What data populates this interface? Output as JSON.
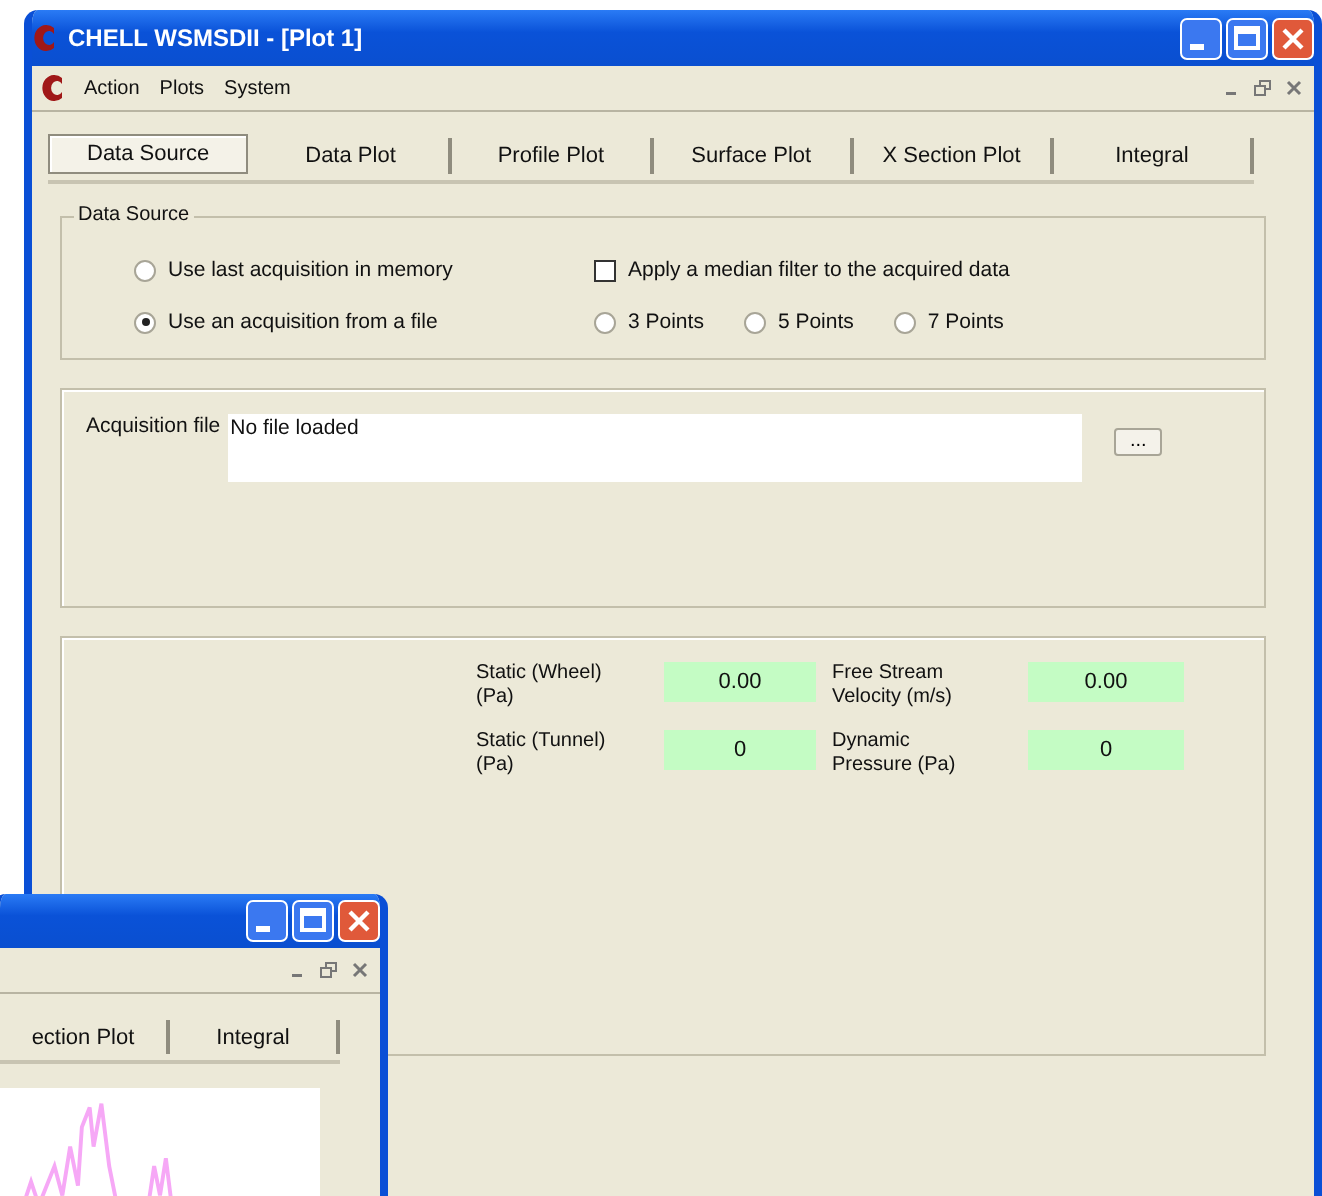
{
  "window": {
    "title": "CHELL WSMSDII - [Plot 1]"
  },
  "menu": [
    "Action",
    "Plots",
    "System"
  ],
  "tabs": [
    {
      "label": "Data Source",
      "selected": true
    },
    {
      "label": "Data Plot",
      "selected": false
    },
    {
      "label": "Profile Plot",
      "selected": false
    },
    {
      "label": "Surface Plot",
      "selected": false
    },
    {
      "label": "X Section Plot",
      "selected": false
    },
    {
      "label": "Integral",
      "selected": false
    }
  ],
  "data_source": {
    "title": "Data Source",
    "options": [
      {
        "label": "Use last acquisition in memory",
        "selected": false
      },
      {
        "label": "Use an acquisition from a file",
        "selected": true
      }
    ],
    "median_filter": {
      "label": "Apply a median filter to the acquired data",
      "checked": false
    },
    "points": [
      {
        "label": "3 Points",
        "selected": false
      },
      {
        "label": "5 Points",
        "selected": false
      },
      {
        "label": "7 Points",
        "selected": false
      }
    ]
  },
  "acquisition": {
    "label": "Acquisition file",
    "value": "No file loaded",
    "browse": "..."
  },
  "readings": [
    {
      "label": "Static (Wheel) (Pa)",
      "value": "0.00"
    },
    {
      "label": "Free Stream Velocity (m/s)",
      "value": "0.00"
    },
    {
      "label": "Static (Tunnel) (Pa)",
      "value": "0"
    },
    {
      "label": "Dynamic Pressure (Pa)",
      "value": "0"
    }
  ],
  "second_window": {
    "tabs": [
      {
        "label": "ection Plot",
        "selected": false
      },
      {
        "label": "Integral",
        "selected": false
      }
    ]
  }
}
